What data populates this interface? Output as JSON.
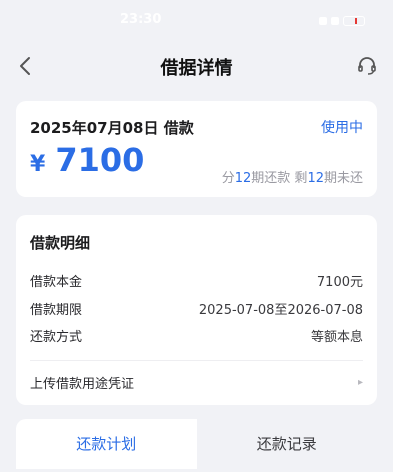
{
  "status_bar": {
    "time": "23:30"
  },
  "nav": {
    "title": "借据详情"
  },
  "summary": {
    "date_title": "2025年07月08日 借款",
    "status": "使用中",
    "currency": "¥",
    "amount": "7100",
    "terms_prefix": "分",
    "terms_total": "12",
    "terms_mid": "期还款 剩",
    "terms_left": "12",
    "terms_suffix": "期未还"
  },
  "detail": {
    "heading": "借款明细",
    "rows": [
      {
        "label": "借款本金",
        "value": "7100元"
      },
      {
        "label": "借款期限",
        "value": "2025-07-08至2026-07-08"
      },
      {
        "label": "还款方式",
        "value": "等额本息"
      }
    ],
    "upload_label": "上传借款用途凭证"
  },
  "tabs": [
    {
      "label": "还款计划",
      "active": true
    },
    {
      "label": "还款记录",
      "active": false
    }
  ],
  "colors": {
    "accent": "#2b6de5",
    "background": "#f1f2f6"
  },
  "icons": {
    "back": "chevron-left-icon",
    "service": "headset-icon",
    "upload_arrow": "chevron-right-icon"
  }
}
